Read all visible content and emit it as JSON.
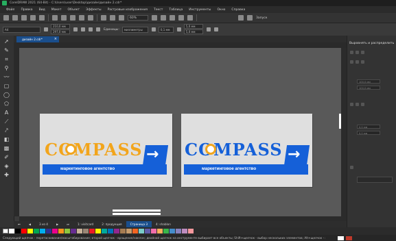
{
  "window": {
    "title": "CorelDRAW 2021 (64-Bit) - C:\\Users\\user\\Desktop\\дизайн\\дизайн 2.cdr*"
  },
  "menu": [
    "Файл",
    "Правка",
    "Вид",
    "Макет",
    "Объект",
    "Эффекты",
    "Растровые изображения",
    "Текст",
    "Таблица",
    "Инструменты",
    "Окно",
    "Справка"
  ],
  "toolbar": {
    "zoom": "60%",
    "launch_label": "Запуск"
  },
  "property_bar": {
    "preset": "A4",
    "width": "210,0 мм",
    "height": "297,0 мм",
    "units_label": "Единицы:",
    "units_value": "миллиметры",
    "nudge": "0,1 мм",
    "dup_x": "5,0 мм",
    "dup_y": "5,0 мм"
  },
  "document_tab": {
    "label": "дизайн 2.cdr*",
    "close": "×"
  },
  "pages": {
    "count_text": "3 из 4",
    "tabs": [
      "1: visitcard",
      "2: продукция",
      "Страница 3",
      "4: shablon"
    ],
    "active_index": 2
  },
  "docker": {
    "title": "Выровнять и распределить",
    "fields": [
      "100,0 мм",
      "100,0 мм",
      "0,0 мм",
      "0,0 мм"
    ]
  },
  "canvas": {
    "logo_text_left": "COMPASS",
    "logo_text_right": "COMPASS",
    "tagline": "маркетинговое агентство",
    "arrow": "→",
    "colors": {
      "orange": "#f2a51c",
      "blue": "#1560d8",
      "page": "#dfdfdf",
      "canvas": "#595959"
    }
  },
  "palette": [
    "#ffffff",
    "#000000",
    "#ff0000",
    "#ffff00",
    "#00a651",
    "#00aeef",
    "#2e3192",
    "#ec008c",
    "#f7941d",
    "#8dc63f",
    "#662d91",
    "#c7b299",
    "#998675",
    "#ed1c24",
    "#fff200",
    "#00a99d",
    "#0072bc",
    "#92278f",
    "#a67c52",
    "#c69c6d",
    "#f26522",
    "#7accc8",
    "#605ca8",
    "#f06eaa",
    "#fbaf5d",
    "#39b54a",
    "#448ccb",
    "#8781bd",
    "#bd8cbf",
    "#f5989d"
  ],
  "status": {
    "text": "Следующий щелчок - перетаскивание/масштабирование; второй щелчок - вращение/наклон; двойной щелчок на инструменте выбирает все объекты; Shift+щелчок - выбор нескольких элементов; Alt+щелчок - выбор"
  },
  "icons": {
    "tools": [
      "pointer-icon",
      "shape-icon",
      "crop-icon",
      "zoom-icon",
      "freehand-icon",
      "rectangle-icon",
      "ellipse-icon",
      "polygon-icon",
      "text-icon",
      "parallel-dimension-icon",
      "connector-icon",
      "shadow-icon",
      "transparency-icon",
      "eyedropper-icon",
      "fill-icon",
      "smart-fill-icon"
    ]
  }
}
